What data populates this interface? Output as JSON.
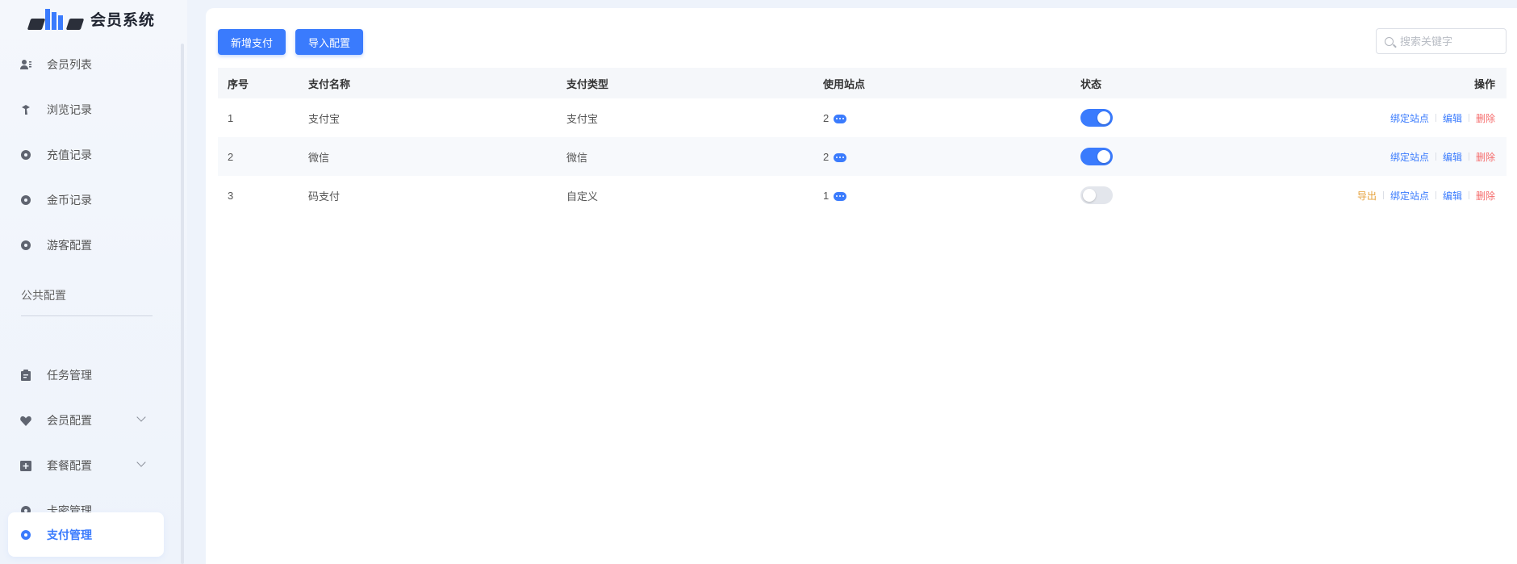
{
  "app": {
    "logo_text": "会员系统",
    "logo_mark": "cms"
  },
  "sidebar": {
    "items": [
      {
        "label": "会员列表",
        "icon": "users-icon"
      },
      {
        "label": "浏览记录",
        "icon": "browse-icon"
      },
      {
        "label": "充值记录",
        "icon": "dot-icon"
      },
      {
        "label": "金币记录",
        "icon": "dot-icon"
      },
      {
        "label": "游客配置",
        "icon": "dot-icon"
      }
    ],
    "section_title": "公共配置",
    "items2": [
      {
        "label": "任务管理",
        "icon": "clipboard-icon"
      },
      {
        "label": "会员配置",
        "icon": "heart-icon",
        "expandable": true
      },
      {
        "label": "套餐配置",
        "icon": "plus-box-icon",
        "expandable": true
      },
      {
        "label": "卡密管理",
        "icon": "dot-icon"
      },
      {
        "label": "支付管理",
        "icon": "dot-icon",
        "active": true
      }
    ]
  },
  "toolbar": {
    "add_label": "新增支付",
    "import_label": "导入配置",
    "search_placeholder": "搜索关键字"
  },
  "table": {
    "headers": [
      "序号",
      "支付名称",
      "支付类型",
      "使用站点",
      "状态",
      "操作"
    ],
    "rows": [
      {
        "index": "1",
        "name": "支付宝",
        "type": "支付宝",
        "sites": "2",
        "enabled": true,
        "actions": [
          "绑定站点",
          "编辑",
          "删除"
        ]
      },
      {
        "index": "2",
        "name": "微信",
        "type": "微信",
        "sites": "2",
        "enabled": true,
        "actions": [
          "绑定站点",
          "编辑",
          "删除"
        ]
      },
      {
        "index": "3",
        "name": "码支付",
        "type": "自定义",
        "sites": "1",
        "enabled": false,
        "actions": [
          "导出",
          "绑定站点",
          "编辑",
          "删除"
        ]
      }
    ]
  },
  "colors": {
    "accent": "#3a7bfd",
    "danger": "#f56c6c",
    "warning": "#e6a23c"
  }
}
